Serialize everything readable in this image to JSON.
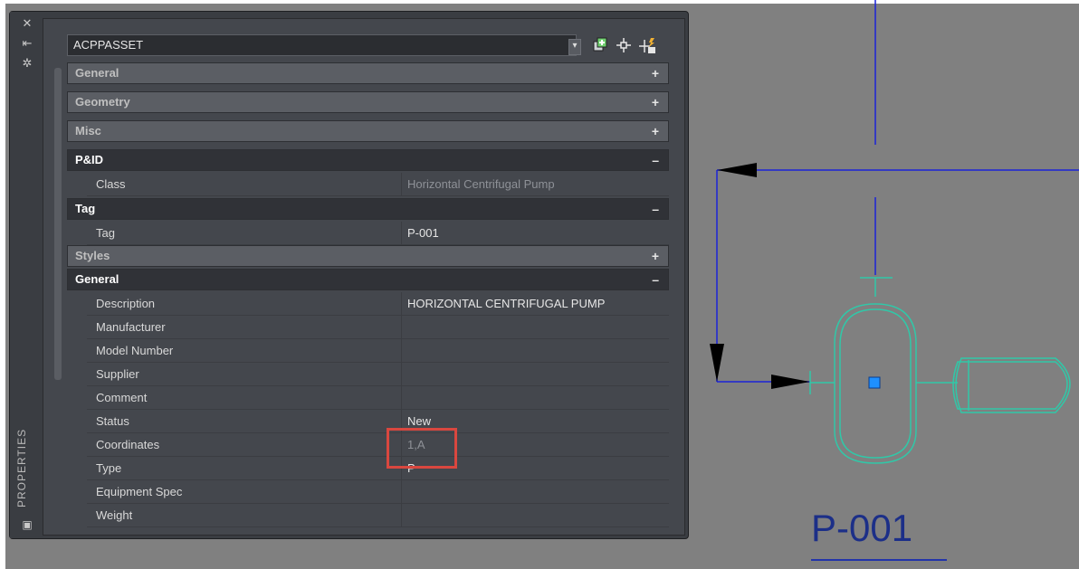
{
  "palette": {
    "side_label": "PROPERTIES",
    "selector_value": "ACPPASSET",
    "icons": [
      "close-icon",
      "pin-icon",
      "settings-icon",
      "properties-icon",
      "quick-select-icon",
      "pick-object-icon",
      "toggle-pickadd-icon"
    ]
  },
  "categories": {
    "general_top": {
      "label": "General",
      "toggle": "+"
    },
    "geometry": {
      "label": "Geometry",
      "toggle": "+"
    },
    "misc": {
      "label": "Misc",
      "toggle": "+"
    },
    "pid": {
      "label": "P&ID",
      "toggle": "–"
    },
    "tag": {
      "label": "Tag",
      "toggle": "–"
    },
    "styles": {
      "label": "Styles",
      "toggle": "+"
    },
    "general": {
      "label": "General",
      "toggle": "–"
    }
  },
  "rows": {
    "class": {
      "name": "Class",
      "value": "Horizontal Centrifugal Pump"
    },
    "tag": {
      "name": "Tag",
      "value": "P-001"
    },
    "description": {
      "name": "Description",
      "value": "HORIZONTAL CENTRIFUGAL PUMP"
    },
    "manufacturer": {
      "name": "Manufacturer",
      "value": ""
    },
    "model_number": {
      "name": "Model Number",
      "value": ""
    },
    "supplier": {
      "name": "Supplier",
      "value": ""
    },
    "comment": {
      "name": "Comment",
      "value": ""
    },
    "status": {
      "name": "Status",
      "value": "New"
    },
    "coordinates": {
      "name": "Coordinates",
      "value": "1,A"
    },
    "type": {
      "name": "Type",
      "value": "P"
    },
    "equipment_spec": {
      "name": "Equipment Spec",
      "value": ""
    },
    "weight": {
      "name": "Weight",
      "value": ""
    }
  },
  "drawing": {
    "tag_label": "P-001",
    "line_color": "#1a22d8",
    "equipment_color": "#30c8a8",
    "arrow_color": "#000000"
  }
}
